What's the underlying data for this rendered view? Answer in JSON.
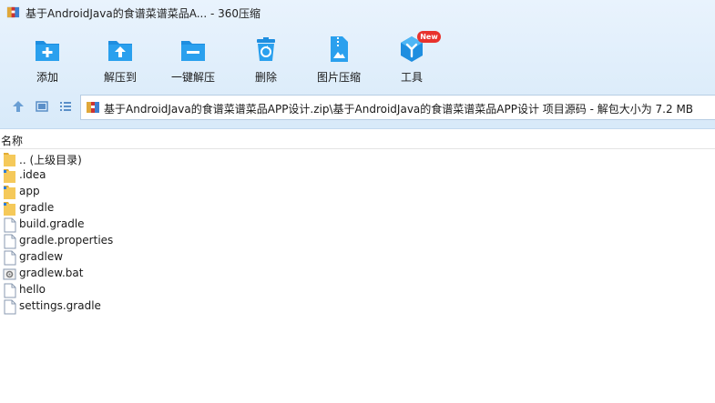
{
  "window": {
    "title": "基于AndroidJava的食谱菜谱菜品A... - 360压缩"
  },
  "toolbar": {
    "add_label": "添加",
    "extract_to_label": "解压到",
    "one_click_extract_label": "一键解压",
    "delete_label": "删除",
    "image_compress_label": "图片压缩",
    "tools_label": "工具",
    "tools_badge": "New"
  },
  "address": {
    "path": "基于AndroidJava的食谱菜谱菜品APP设计.zip\\基于AndroidJava的食谱菜谱菜品APP设计 项目源码 - 解包大小为 7.2 MB"
  },
  "columns": {
    "name": "名称"
  },
  "files": [
    {
      "name": ".. (上级目录)",
      "type": "folder-up"
    },
    {
      "name": ".idea",
      "type": "folder"
    },
    {
      "name": "app",
      "type": "folder"
    },
    {
      "name": "gradle",
      "type": "folder"
    },
    {
      "name": "build.gradle",
      "type": "file"
    },
    {
      "name": "gradle.properties",
      "type": "file"
    },
    {
      "name": "gradlew",
      "type": "file"
    },
    {
      "name": "gradlew.bat",
      "type": "bat"
    },
    {
      "name": "hello",
      "type": "file"
    },
    {
      "name": "settings.gradle",
      "type": "file"
    }
  ],
  "colors": {
    "accent": "#1e8ee0",
    "folder": "#f5c95a",
    "badge": "#e8322d"
  }
}
